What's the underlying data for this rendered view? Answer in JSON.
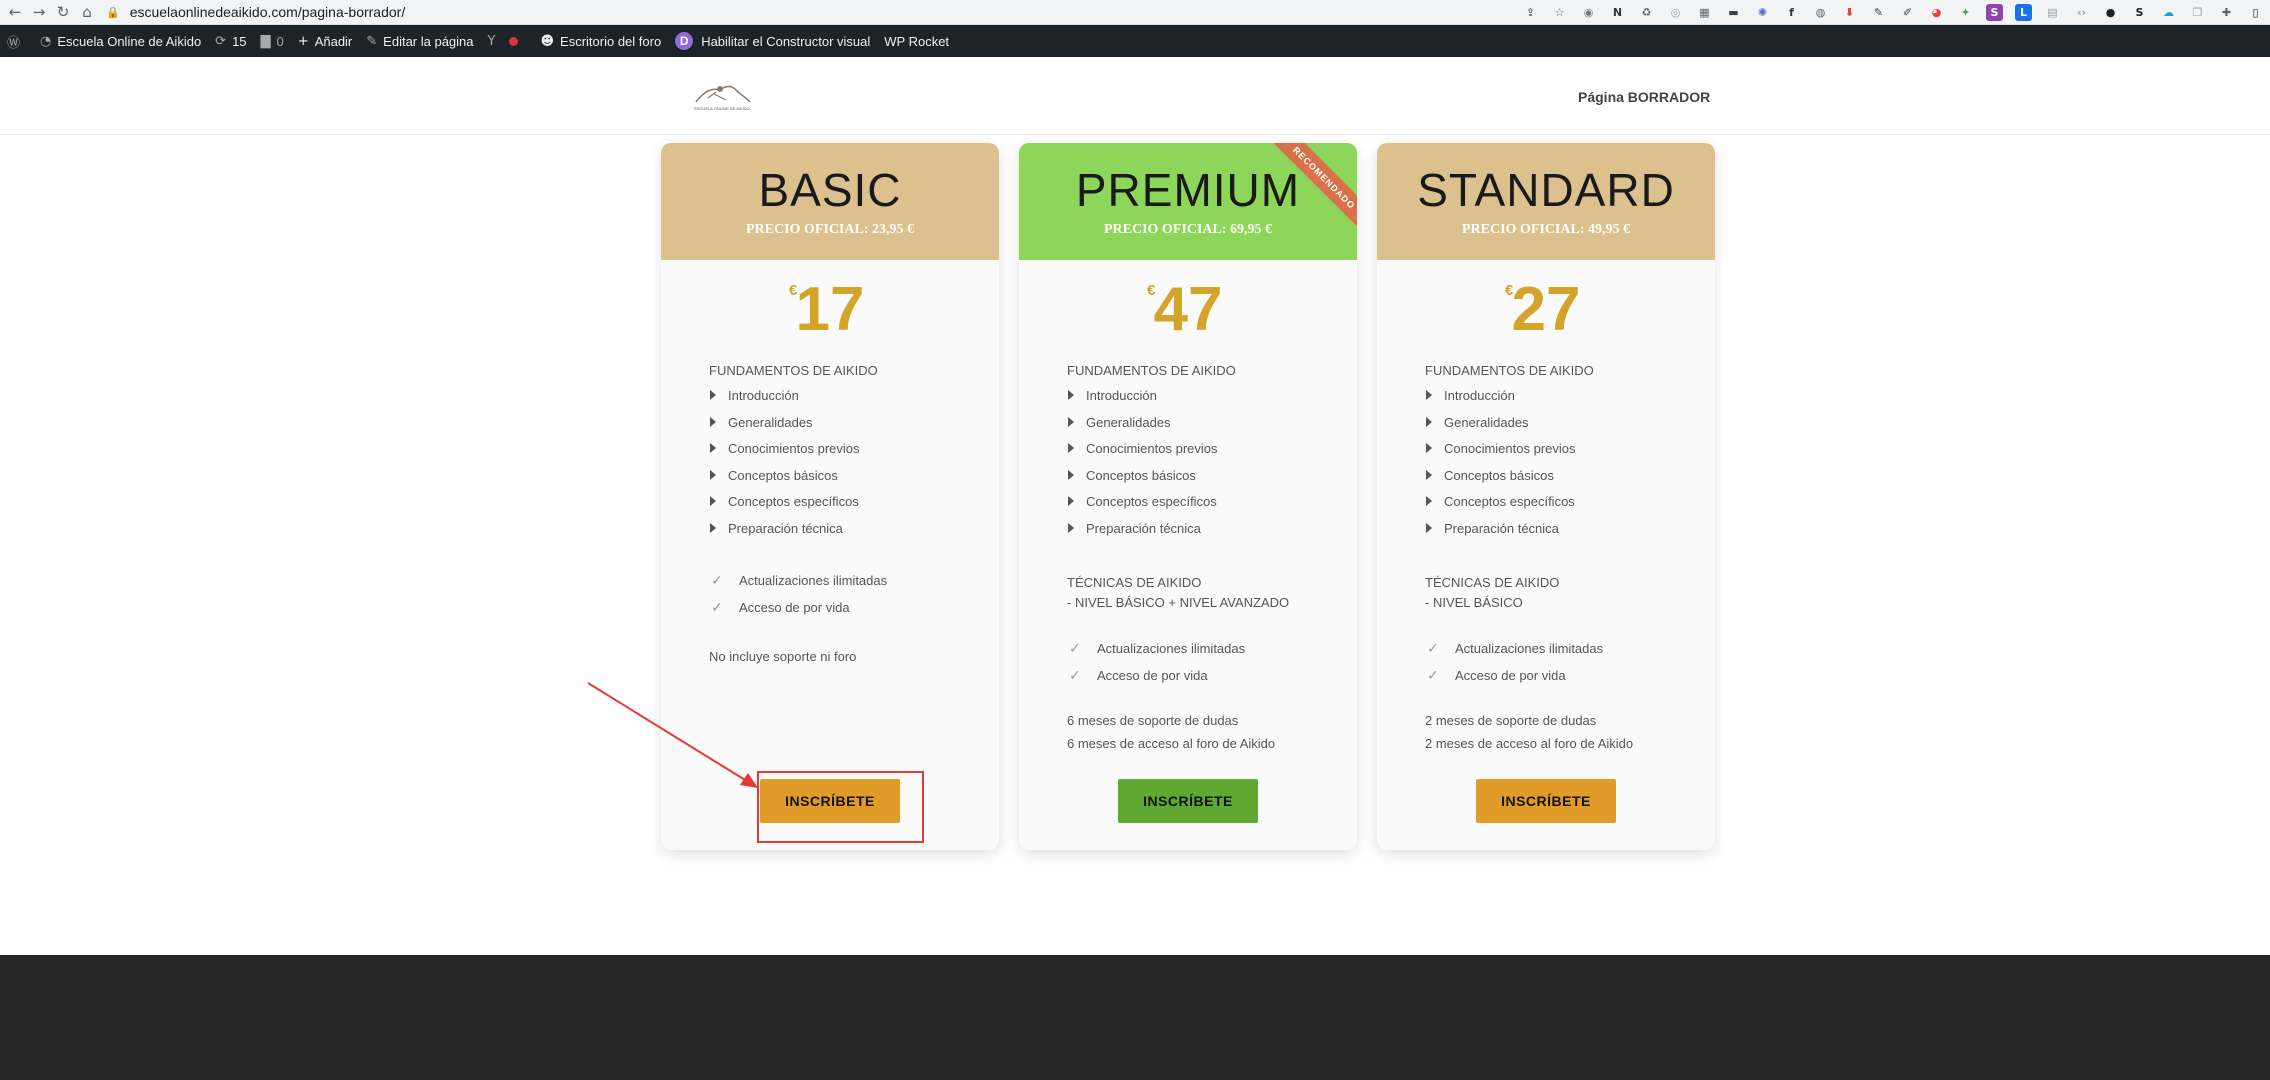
{
  "browser": {
    "back": "←",
    "forward": "→",
    "reload": "↻",
    "home": "⌂",
    "lock": "🔒",
    "url": "escuelaonlinedeaikido.com/pagina-borrador/",
    "extensions": [
      "share-icon",
      "star-icon",
      "github-icon",
      "notion-icon",
      "recycle-icon",
      "compass-icon",
      "calendar-icon",
      "keyboard-icon",
      "sun-icon",
      "function-icon",
      "lock-ext-icon",
      "download-icon",
      "edit-icon",
      "pen-icon",
      "colorwheel-icon",
      "puzzle-green-icon",
      "s-icon",
      "li-icon",
      "grid-icon",
      "code-icon",
      "dark-circle-icon",
      "s-dark-icon",
      "cloud-icon",
      "copy-icon",
      "puzzle-icon",
      "sidebar-icon"
    ]
  },
  "wpbar": {
    "site_name": "Escuela Online de Aikido",
    "updates_count": "15",
    "comments_count": "0",
    "add_new": "Añadir",
    "edit_page": "Editar la página",
    "forum_desk": "Escritorio del foro",
    "visual_builder": "Habilitar el Constructor visual",
    "wp_rocket": "WP Rocket",
    "divi_letter": "D"
  },
  "header": {
    "logo_text": "ESCUELA ONLINE DE AIKIDO",
    "menu_item": "Página BORRADOR"
  },
  "plans": [
    {
      "name": "BASIC",
      "official_price": "PRECIO OFICIAL: 23,95 €",
      "currency": "€",
      "price": "17",
      "section1": "FUNDAMENTOS DE AIKIDO",
      "items": [
        "Introducción",
        "Generalidades",
        "Conocimientos previos",
        "Conceptos básicos",
        "Conceptos específicos",
        "Preparación técnica"
      ],
      "features": [
        "Actualizaciones ilimitadas",
        "Acceso de por vida"
      ],
      "notes": [
        "No incluye soporte ni foro"
      ],
      "button": "INSCRÍBETE",
      "head_color": "#dcc18e"
    },
    {
      "name": "PREMIUM",
      "official_price": "PRECIO OFICIAL: 69,95 €",
      "currency": "€",
      "price": "47",
      "ribbon": "RECOMENDADO",
      "section1": "FUNDAMENTOS DE AIKIDO",
      "items": [
        "Introducción",
        "Generalidades",
        "Conocimientos previos",
        "Conceptos básicos",
        "Conceptos específicos",
        "Preparación técnica"
      ],
      "section2": "TÉCNICAS DE AIKIDO",
      "section2_sub": "- NIVEL BÁSICO + NIVEL AVANZADO",
      "features": [
        "Actualizaciones ilimitadas",
        "Acceso de por vida"
      ],
      "notes": [
        "6 meses de soporte de dudas",
        "6 meses de acceso al foro de Aikido"
      ],
      "button": "INSCRÍBETE",
      "head_color": "#8dd65a"
    },
    {
      "name": "STANDARD",
      "official_price": "PRECIO OFICIAL: 49,95 €",
      "currency": "€",
      "price": "27",
      "section1": "FUNDAMENTOS DE AIKIDO",
      "items": [
        "Introducción",
        "Generalidades",
        "Conocimientos previos",
        "Conceptos básicos",
        "Conceptos específicos",
        "Preparación técnica"
      ],
      "section2": "TÉCNICAS DE AIKIDO",
      "section2_sub": "- NIVEL BÁSICO",
      "features": [
        "Actualizaciones ilimitadas",
        "Acceso de por vida"
      ],
      "notes": [
        "2 meses de soporte de dudas",
        "2 meses de acceso al foro de Aikido"
      ],
      "button": "INSCRÍBETE",
      "head_color": "#dcc18e"
    }
  ],
  "colors": {
    "price": "#d4a32a",
    "orange_button": "#e09b28",
    "green_button": "#5fa832",
    "annotation": "#e53935"
  }
}
